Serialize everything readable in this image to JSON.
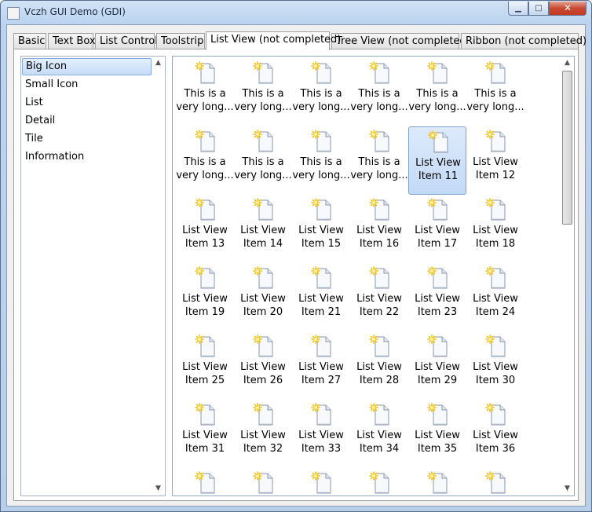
{
  "window": {
    "title": "Vczh GUI Demo (GDI)",
    "buttons": {
      "minimize": "▁",
      "maximize": "□",
      "close": "✕"
    }
  },
  "tabs": [
    {
      "label": "Basic"
    },
    {
      "label": "Text Box"
    },
    {
      "label": "List Control"
    },
    {
      "label": "Toolstrip"
    },
    {
      "label": "List View (not completed)",
      "active": true
    },
    {
      "label": "Tree View (not completed)"
    },
    {
      "label": "Ribbon (not completed)"
    }
  ],
  "view_modes": {
    "selected": "Big Icon",
    "items": [
      "Big Icon",
      "Small Icon",
      "List",
      "Detail",
      "Tile",
      "Information"
    ]
  },
  "list_view": {
    "selected_item": "List View\nItem 11",
    "items": [
      "This is a\nvery long...",
      "This is a\nvery long...",
      "This is a\nvery long...",
      "This is a\nvery long...",
      "This is a\nvery long...",
      "This is a\nvery long...",
      "This is a\nvery long...",
      "This is a\nvery long...",
      "This is a\nvery long...",
      "This is a\nvery long...",
      "List View\nItem 11",
      "List View\nItem 12",
      "List View\nItem 13",
      "List View\nItem 14",
      "List View\nItem 15",
      "List View\nItem 16",
      "List View\nItem 17",
      "List View\nItem 18",
      "List View\nItem 19",
      "List View\nItem 20",
      "List View\nItem 21",
      "List View\nItem 22",
      "List View\nItem 23",
      "List View\nItem 24",
      "List View\nItem 25",
      "List View\nItem 26",
      "List View\nItem 27",
      "List View\nItem 28",
      "List View\nItem 29",
      "List View\nItem 30",
      "List View\nItem 31",
      "List View\nItem 32",
      "List View\nItem 33",
      "List View\nItem 34",
      "List View\nItem 35",
      "List View\nItem 36",
      "",
      "",
      "",
      "",
      "",
      ""
    ],
    "scroll_position": 0.0
  },
  "scroll_arrows": {
    "up": "▲",
    "down": "▼"
  },
  "icon_name": "new-document-icon",
  "colors": {
    "selection": "#c6dcf7",
    "sparkle": "#f4c20d"
  }
}
